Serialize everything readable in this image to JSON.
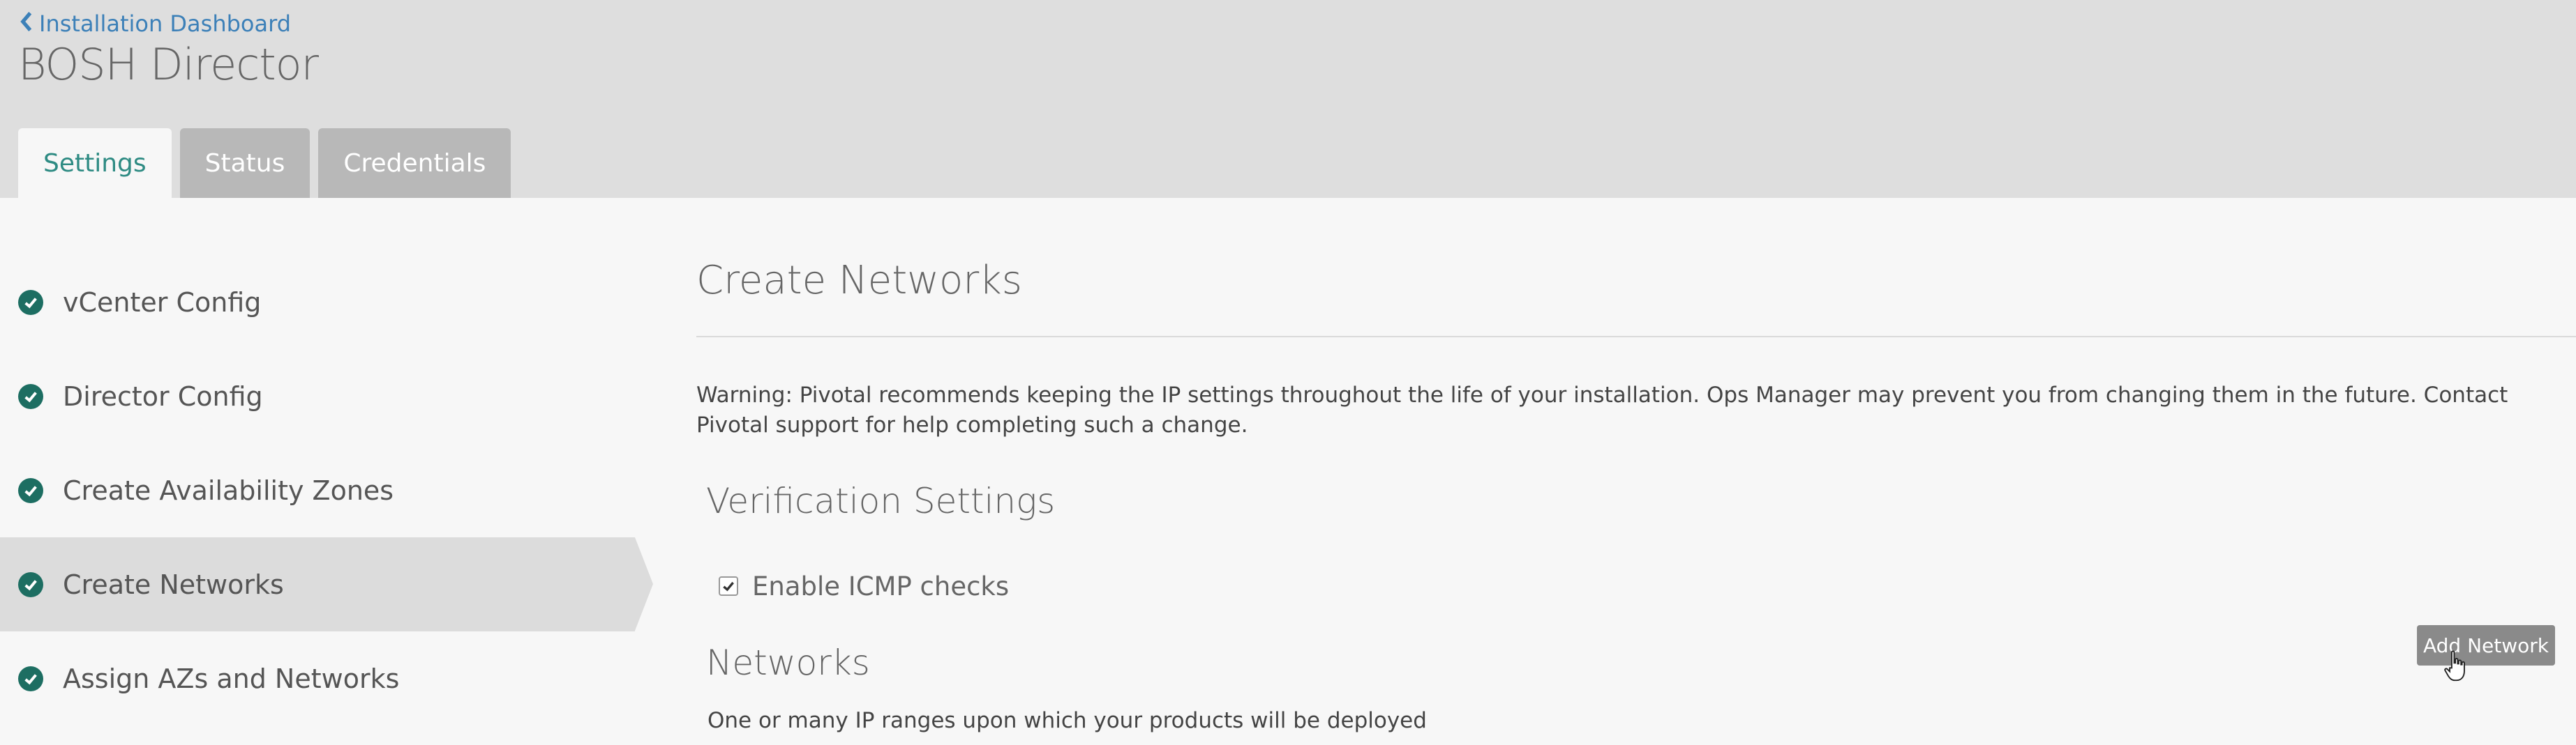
{
  "header": {
    "back_link_label": "Installation Dashboard",
    "title": "BOSH Director",
    "tabs": [
      {
        "label": "Settings",
        "active": true
      },
      {
        "label": "Status",
        "active": false
      },
      {
        "label": "Credentials",
        "active": false
      }
    ]
  },
  "sidebar": {
    "items": [
      {
        "label": "vCenter Config",
        "complete": true,
        "active": false
      },
      {
        "label": "Director Config",
        "complete": true,
        "active": false
      },
      {
        "label": "Create Availability Zones",
        "complete": true,
        "active": false
      },
      {
        "label": "Create Networks",
        "complete": true,
        "active": true
      },
      {
        "label": "Assign AZs and Networks",
        "complete": true,
        "active": false
      }
    ]
  },
  "main": {
    "title": "Create Networks",
    "warning": "Warning: Pivotal recommends keeping the IP settings throughout the life of your installation. Ops Manager may prevent you from changing them in the future. Contact Pivotal support for help completing such a change.",
    "verification": {
      "title": "Verification Settings",
      "checkbox_label": "Enable ICMP checks",
      "checked": true
    },
    "networks": {
      "title": "Networks",
      "description": "One or many IP ranges upon which your products will be deployed",
      "add_button_label": "Add Network"
    }
  },
  "colors": {
    "header_bg": "#dedede",
    "page_bg": "#f7f7f7",
    "link": "#3c80b8",
    "active_tab_text": "#2e8b83",
    "check_icon": "#1d6e62",
    "button_bg": "#8a8a8a"
  }
}
